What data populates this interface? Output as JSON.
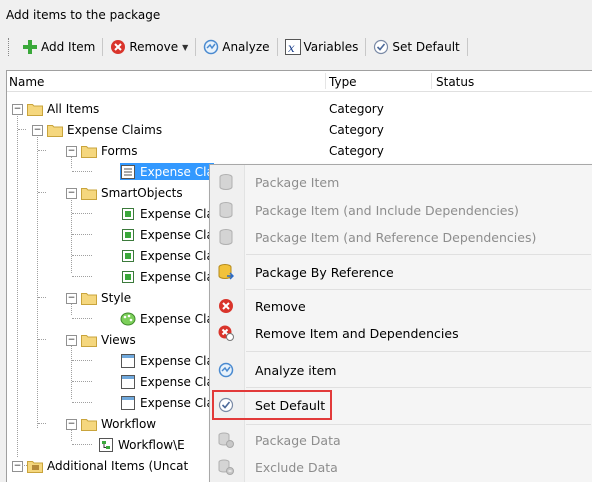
{
  "title": "Add items to the package",
  "toolbar": {
    "add_item": "Add Item",
    "remove": "Remove",
    "analyze": "Analyze",
    "variables": "Variables",
    "set_default": "Set Default"
  },
  "columns": {
    "name": "Name",
    "type": "Type",
    "status": "Status"
  },
  "tree": {
    "all_items": {
      "name": "All Items",
      "type": "Category"
    },
    "expense_claims": {
      "name": "Expense Claims",
      "type": "Category"
    },
    "forms": {
      "name": "Forms",
      "type": "Category"
    },
    "form_item": "Expense Cla",
    "smartobjects": "SmartObjects",
    "smo_items": [
      "Expense Cla",
      "Expense Cla",
      "Expense Cla",
      "Expense Cla"
    ],
    "style": "Style",
    "style_item": "Expense Cla",
    "views": "Views",
    "view_items": [
      "Expense Cla",
      "Expense Cla",
      "Expense Cla"
    ],
    "workflow": "Workflow",
    "workflow_item": "Workflow\\E",
    "additional": "Additional Items (Uncat"
  },
  "context_menu": {
    "package_item": "Package Item",
    "package_item_include": "Package Item (and Include Dependencies)",
    "package_item_reference": "Package Item (and Reference Dependencies)",
    "package_by_reference": "Package By Reference",
    "remove": "Remove",
    "remove_deps": "Remove Item and Dependencies",
    "analyze_item": "Analyze item",
    "set_default": "Set Default",
    "package_data": "Package Data",
    "exclude_data": "Exclude Data"
  },
  "colors": {
    "selection": "#3399ff",
    "highlight_border": "#e23a3a",
    "folder": "#f5d77e"
  }
}
